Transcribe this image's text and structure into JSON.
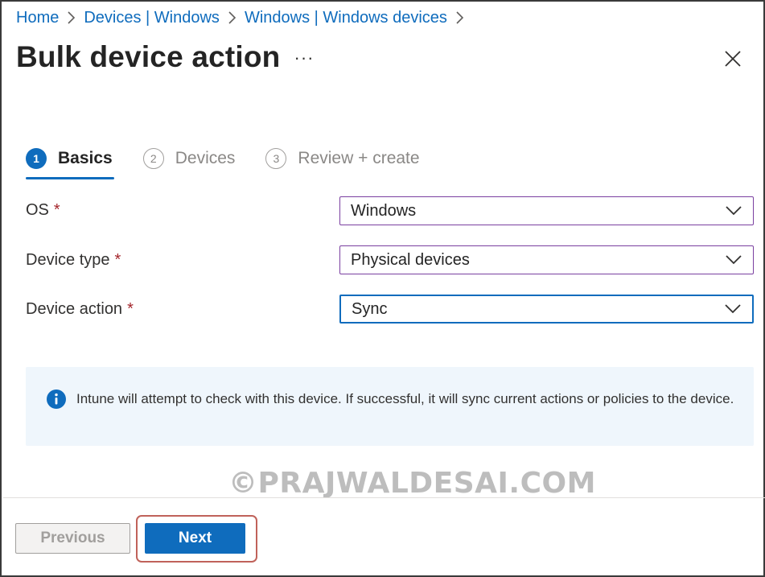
{
  "breadcrumb": {
    "items": [
      "Home",
      "Devices | Windows",
      "Windows | Windows devices"
    ]
  },
  "page": {
    "title": "Bulk device action",
    "more_label": "···"
  },
  "wizard": {
    "steps": [
      {
        "number": "1",
        "label": "Basics",
        "state": "active"
      },
      {
        "number": "2",
        "label": "Devices",
        "state": "inactive"
      },
      {
        "number": "3",
        "label": "Review + create",
        "state": "inactive"
      }
    ]
  },
  "form": {
    "required_marker": "*",
    "os": {
      "label": "OS",
      "value": "Windows"
    },
    "device_type": {
      "label": "Device type",
      "value": "Physical devices"
    },
    "device_action": {
      "label": "Device action",
      "value": "Sync"
    }
  },
  "info": {
    "text": "Intune will attempt to check with this device. If successful, it will sync current actions or policies to the device."
  },
  "watermark": "©PRAJWALDESAI.COM",
  "footer": {
    "previous_label": "Previous",
    "next_label": "Next"
  },
  "colors": {
    "accent": "#0f6cbd",
    "required": "#a4262c",
    "info_background": "#eff6fc",
    "highlight_outline": "#c0625a"
  }
}
